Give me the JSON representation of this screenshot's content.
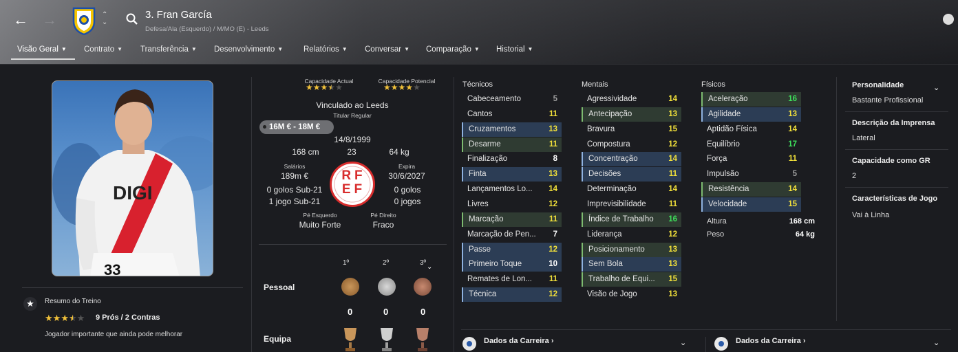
{
  "header": {
    "player_name": "3. Fran García",
    "player_sub": "Defesa/Ala (Esquerdo) / M/MO (E) - Leeds",
    "tabs": [
      {
        "label": "Visão Geral"
      },
      {
        "label": "Contrato"
      },
      {
        "label": "Transferência"
      },
      {
        "label": "Desenvolvimento"
      },
      {
        "label": "Relatórios"
      },
      {
        "label": "Conversar"
      },
      {
        "label": "Comparação"
      },
      {
        "label": "Historial"
      }
    ]
  },
  "training": {
    "title": "Resumo do Treino",
    "rating_stars": 3.5,
    "stars_text": "★★★★★",
    "pros_cons": "9 Prós / 2 Contras",
    "note": "Jogador importante que ainda pode melhorar"
  },
  "overview": {
    "current_ability_label": "Capacidade Actual",
    "current_ability_stars": 3.5,
    "potential_ability_label": "Capacidade Potencial",
    "potential_ability_stars": 4,
    "stars_text": "★★★★★",
    "contract_status": "Vinculado ao Leeds",
    "squad_status": "Titular Regular",
    "value": "16M € - 18M €",
    "dob": "14/8/1999",
    "height": "168 cm",
    "age": "23",
    "weight": "64 kg",
    "wages_label": "Salários",
    "wages": "189m €",
    "expires_label": "Expira",
    "expires": "30/6/2027",
    "u21_goals": "0 golos Sub-21",
    "u21_caps": "1 jogo Sub-21",
    "goals": "0 golos",
    "caps": "0 jogos",
    "left_foot_label": "Pé Esquerdo",
    "left_foot": "Muito Forte",
    "right_foot_label": "Pé Direito",
    "right_foot": "Fraco",
    "badge_text": "RFEF"
  },
  "awards": {
    "places": [
      "1º",
      "2º",
      "3º"
    ],
    "personal_label": "Pessoal",
    "personal_counts": [
      "0",
      "0",
      "0"
    ],
    "team_label": "Equipa"
  },
  "technical": {
    "title": "Técnicos",
    "attrs": [
      {
        "name": "Cabeceamento",
        "value": "5"
      },
      {
        "name": "Cantos",
        "value": "11"
      },
      {
        "name": "Cruzamentos",
        "value": "13"
      },
      {
        "name": "Desarme",
        "value": "11"
      },
      {
        "name": "Finalização",
        "value": "8"
      },
      {
        "name": "Finta",
        "value": "13"
      },
      {
        "name": "Lançamentos Lo...",
        "value": "14"
      },
      {
        "name": "Livres",
        "value": "12"
      },
      {
        "name": "Marcação",
        "value": "11"
      },
      {
        "name": "Marcação de Pen...",
        "value": "7"
      },
      {
        "name": "Passe",
        "value": "12"
      },
      {
        "name": "Primeiro Toque",
        "value": "10"
      },
      {
        "name": "Remates de Lon...",
        "value": "11"
      },
      {
        "name": "Técnica",
        "value": "12"
      }
    ]
  },
  "mental": {
    "title": "Mentais",
    "attrs": [
      {
        "name": "Agressividade",
        "value": "14"
      },
      {
        "name": "Antecipação",
        "value": "13"
      },
      {
        "name": "Bravura",
        "value": "15"
      },
      {
        "name": "Compostura",
        "value": "12"
      },
      {
        "name": "Concentração",
        "value": "14"
      },
      {
        "name": "Decisões",
        "value": "11"
      },
      {
        "name": "Determinação",
        "value": "14"
      },
      {
        "name": "Imprevisibilidade",
        "value": "11"
      },
      {
        "name": "Índice de Trabalho",
        "value": "16"
      },
      {
        "name": "Liderança",
        "value": "12"
      },
      {
        "name": "Posicionamento",
        "value": "13"
      },
      {
        "name": "Sem Bola",
        "value": "13"
      },
      {
        "name": "Trabalho de Equi...",
        "value": "15"
      },
      {
        "name": "Visão de Jogo",
        "value": "13"
      }
    ]
  },
  "physical": {
    "title": "Físicos",
    "attrs": [
      {
        "name": "Aceleração",
        "value": "16"
      },
      {
        "name": "Agilidade",
        "value": "13"
      },
      {
        "name": "Aptidão Física",
        "value": "14"
      },
      {
        "name": "Equilíbrio",
        "value": "17"
      },
      {
        "name": "Força",
        "value": "11"
      },
      {
        "name": "Impulsão",
        "value": "5"
      },
      {
        "name": "Resistência",
        "value": "14"
      },
      {
        "name": "Velocidade",
        "value": "15"
      }
    ],
    "height_label": "Altura",
    "height": "168 cm",
    "weight_label": "Peso",
    "weight": "64 kg"
  },
  "profile": {
    "personality_label": "Personalidade",
    "personality": "Bastante Profissional",
    "media_label": "Descrição da Imprensa",
    "media": "Lateral",
    "gk_label": "Capacidade como GR",
    "gk": "2",
    "traits_label": "Características de Jogo",
    "traits": "Vai à Linha"
  },
  "career": {
    "left_title": "Dados da Carreira",
    "right_title": "Dados da Carreira"
  },
  "colors": {
    "highlight_blue": "#2c3d55",
    "highlight_green": "#2f3b32",
    "value_yellow": "#f2e13a",
    "value_green": "#3ee05b"
  }
}
